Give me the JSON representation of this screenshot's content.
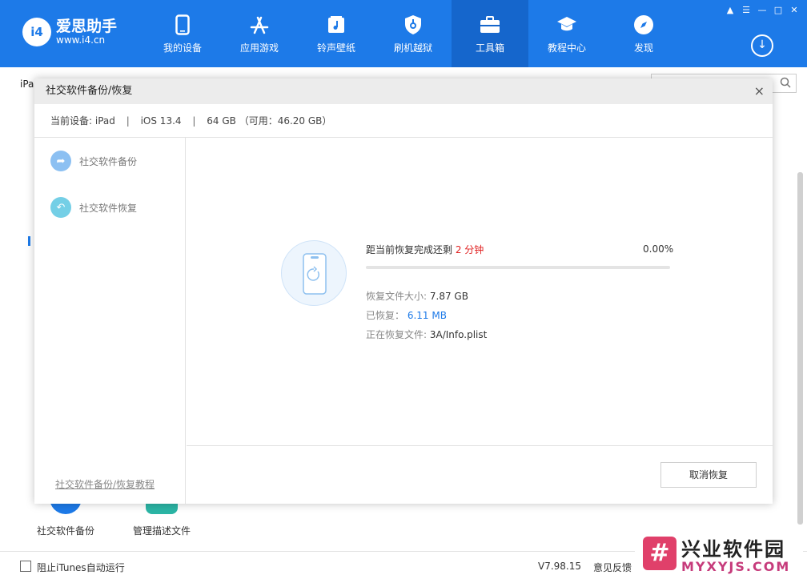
{
  "app": {
    "logo_badge": "i4",
    "logo_title": "爱思助手",
    "logo_sub": "www.i4.cn"
  },
  "nav": {
    "items": [
      {
        "label": "我的设备",
        "icon": "phone-icon"
      },
      {
        "label": "应用游戏",
        "icon": "app-store-icon"
      },
      {
        "label": "铃声壁纸",
        "icon": "music-note-icon"
      },
      {
        "label": "刷机越狱",
        "icon": "shield-icon"
      },
      {
        "label": "工具箱",
        "icon": "toolbox-icon"
      },
      {
        "label": "教程中心",
        "icon": "graduation-cap-icon"
      },
      {
        "label": "发现",
        "icon": "compass-icon"
      }
    ],
    "active": "工具箱"
  },
  "background": {
    "tab": "iPad",
    "tool_a_label": "社交软件备份",
    "tool_b_label": "管理描述文件"
  },
  "status_bar": {
    "itunes_label": "阻止iTunes自动运行",
    "version": "V7.98.15",
    "feedback": "意见反馈"
  },
  "watermark": {
    "mark": "#",
    "title": "兴业软件园",
    "url": "MYXYJS.COM"
  },
  "modal": {
    "title": "社交软件备份/恢复",
    "device": {
      "prefix": "当前设备:",
      "model": "iPad",
      "ios": "iOS 13.4",
      "capacity": "64 GB",
      "available": "（可用：46.20 GB）"
    },
    "sidebar": {
      "backup_label": "社交软件备份",
      "restore_label": "社交软件恢复",
      "tutorial_link": "社交软件备份/恢复教程"
    },
    "progress": {
      "title_prefix": "距当前恢复完成还剩",
      "remaining": "2 分钟",
      "percent_text": "0.00%",
      "fraction": 0.0
    },
    "info": {
      "size_label": "恢复文件大小:",
      "size_value": "7.87 GB",
      "done_label": "已恢复：",
      "done_value": "6.11 MB",
      "file_label": "正在恢复文件:",
      "file_value": "3A/Info.plist"
    },
    "cancel_label": "取消恢复"
  },
  "colors": {
    "brand": "#1d7ae8",
    "remaining": "#e02020"
  }
}
